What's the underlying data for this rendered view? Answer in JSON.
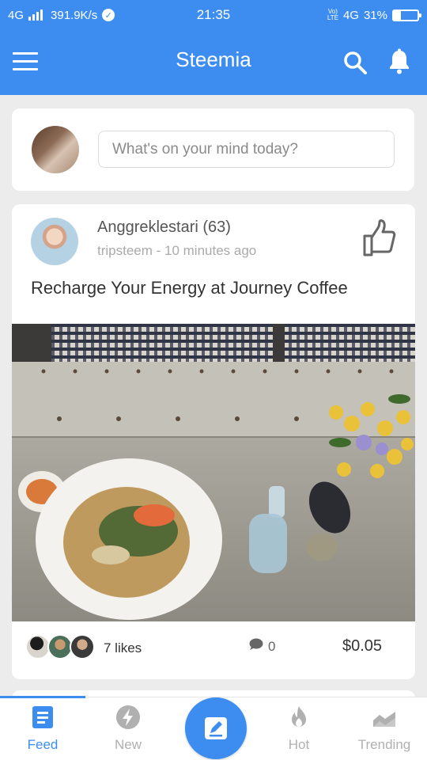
{
  "status_bar": {
    "network": "4G",
    "speed": "391.9K/s",
    "time": "21:35",
    "volte_top": "Vo)",
    "volte_bottom": "LTE",
    "network_right": "4G",
    "battery_percent": "31%",
    "battery_level": 0.31
  },
  "app_bar": {
    "title": "Steemia",
    "icons": [
      "menu-icon",
      "search-icon",
      "bell-icon"
    ]
  },
  "composer": {
    "placeholder": "What's on your mind today?"
  },
  "post": {
    "author": "Anggreklestari (63)",
    "meta": "tripsteem - 10 minutes ago",
    "title": "Recharge Your Energy at Journey Coffee",
    "likes": "7 likes",
    "comments": "0",
    "payout": "$0.05"
  },
  "bottom_nav": {
    "items": [
      {
        "label": "Feed",
        "icon": "feed-icon",
        "active": true
      },
      {
        "label": "New",
        "icon": "bolt-icon",
        "active": false
      },
      {
        "label": "",
        "icon": "compose-icon",
        "active": false
      },
      {
        "label": "Hot",
        "icon": "flame-icon",
        "active": false
      },
      {
        "label": "Trending",
        "icon": "trending-icon",
        "active": false
      }
    ]
  },
  "colors": {
    "primary": "#3d8df1",
    "background": "#ececec",
    "card": "#ffffff",
    "muted": "#b0b0b0"
  }
}
